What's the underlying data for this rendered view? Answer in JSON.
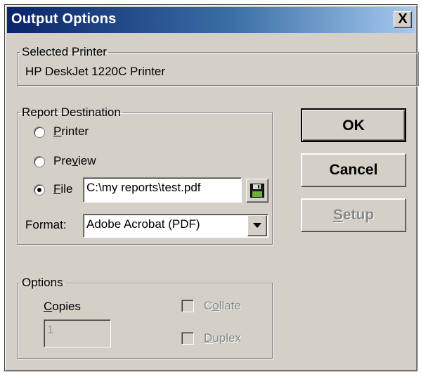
{
  "window": {
    "title": "Output Options",
    "close_label": "X"
  },
  "selected_printer": {
    "legend": "Selected Printer",
    "name": "HP DeskJet 1220C Printer"
  },
  "report_destination": {
    "legend": "Report Destination",
    "options": [
      {
        "mnemonic": "P",
        "rest": "rinter",
        "checked": false
      },
      {
        "before": "Pre",
        "mnemonic": "v",
        "rest": "iew",
        "checked": false
      },
      {
        "mnemonic": "F",
        "rest": "ile",
        "checked": true
      }
    ],
    "file_path": "C:\\my reports\\test.pdf",
    "save_icon": "floppy-disk-icon",
    "format_label": "Format:",
    "format_value": "Adobe Acrobat (PDF)",
    "dropdown_icon": "chevron-down-icon"
  },
  "options": {
    "legend": "Options",
    "copies_mnemonic": "C",
    "copies_rest": "opies",
    "copies_value": "1",
    "collate_before": "C",
    "collate_mnemonic": "o",
    "collate_rest": "llate",
    "duplex_mnemonic": "D",
    "duplex_rest": "uplex"
  },
  "buttons": {
    "ok": "OK",
    "cancel": "Cancel",
    "setup_mnemonic": "S",
    "setup_rest": "etup"
  }
}
